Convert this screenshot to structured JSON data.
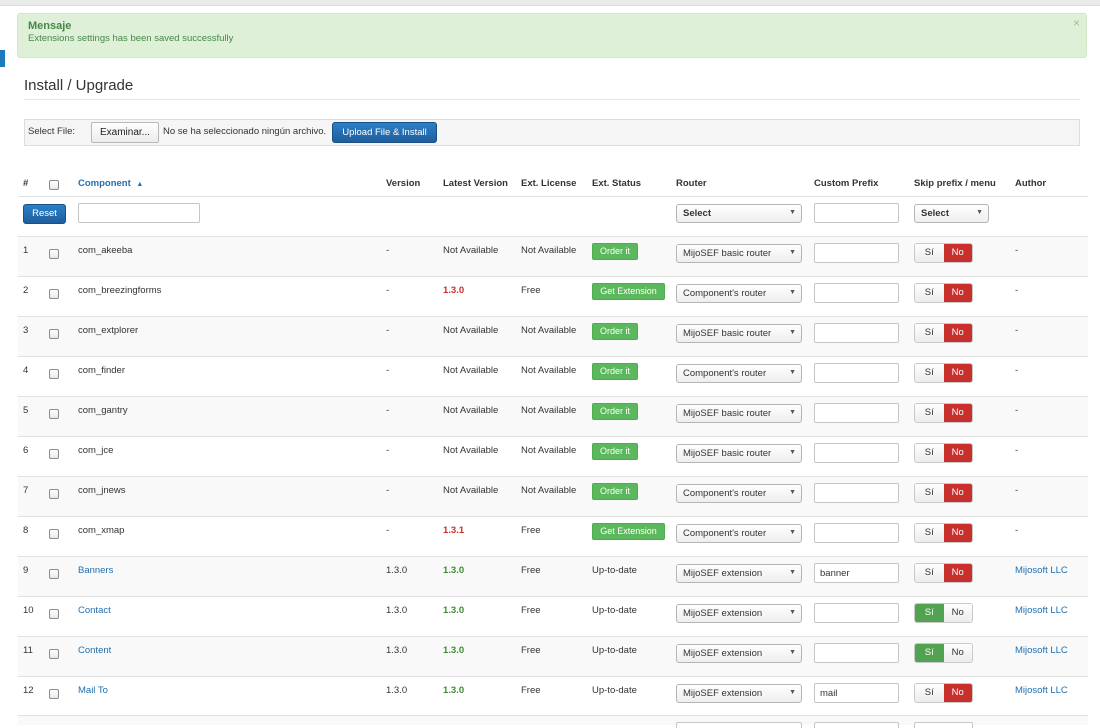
{
  "alert": {
    "heading": "Mensaje",
    "message": "Extensions settings has been saved successfully",
    "close": "×"
  },
  "page_title": "Install / Upgrade",
  "upload": {
    "label": "Select File:",
    "browse_label": "Examinar...",
    "no_file_text": "No se ha seleccionado ningún archivo.",
    "upload_button": "Upload File & Install"
  },
  "table": {
    "headers": {
      "num": "#",
      "component": "Component",
      "sort_indicator": "▲",
      "version": "Version",
      "latest_version": "Latest Version",
      "license": "Ext. License",
      "status": "Ext. Status",
      "router": "Router",
      "prefix": "Custom Prefix",
      "skip": "Skip prefix / menu",
      "author": "Author"
    },
    "filters": {
      "reset_label": "Reset",
      "router_select": "Select",
      "skip_select": "Select"
    },
    "toggle_labels": {
      "yes": "Sí",
      "no": "No"
    },
    "rows": [
      {
        "num": "1",
        "component": "com_akeeba",
        "version": "-",
        "latest": "Not Available",
        "license": "Not Available",
        "status": "Order it",
        "router": "MijoSEF basic router",
        "prefix": "",
        "skip": "No",
        "author": "-"
      },
      {
        "num": "2",
        "component": "com_breezingforms",
        "version": "-",
        "latest": "1.3.0",
        "license": "Free",
        "status": "Get Extension",
        "router": "Component's router",
        "prefix": "",
        "skip": "No",
        "author": "-"
      },
      {
        "num": "3",
        "component": "com_extplorer",
        "version": "-",
        "latest": "Not Available",
        "license": "Not Available",
        "status": "Order it",
        "router": "MijoSEF basic router",
        "prefix": "",
        "skip": "No",
        "author": "-"
      },
      {
        "num": "4",
        "component": "com_finder",
        "version": "-",
        "latest": "Not Available",
        "license": "Not Available",
        "status": "Order it",
        "router": "Component's router",
        "prefix": "",
        "skip": "No",
        "author": "-"
      },
      {
        "num": "5",
        "component": "com_gantry",
        "version": "-",
        "latest": "Not Available",
        "license": "Not Available",
        "status": "Order it",
        "router": "MijoSEF basic router",
        "prefix": "",
        "skip": "No",
        "author": "-"
      },
      {
        "num": "6",
        "component": "com_jce",
        "version": "-",
        "latest": "Not Available",
        "license": "Not Available",
        "status": "Order it",
        "router": "MijoSEF basic router",
        "prefix": "",
        "skip": "No",
        "author": "-"
      },
      {
        "num": "7",
        "component": "com_jnews",
        "version": "-",
        "latest": "Not Available",
        "license": "Not Available",
        "status": "Order it",
        "router": "Component's router",
        "prefix": "",
        "skip": "No",
        "author": "-"
      },
      {
        "num": "8",
        "component": "com_xmap",
        "version": "-",
        "latest": "1.3.1",
        "license": "Free",
        "status": "Get Extension",
        "router": "Component's router",
        "prefix": "",
        "skip": "No",
        "author": "-"
      },
      {
        "num": "9",
        "component": "Banners",
        "version": "1.3.0",
        "latest": "1.3.0",
        "license": "Free",
        "status": "Up-to-date",
        "router": "MijoSEF extension",
        "prefix": "banner",
        "skip": "No",
        "author": "Mijosoft LLC"
      },
      {
        "num": "10",
        "component": "Contact",
        "version": "1.3.0",
        "latest": "1.3.0",
        "license": "Free",
        "status": "Up-to-date",
        "router": "MijoSEF extension",
        "prefix": "",
        "skip": "Sí",
        "author": "Mijosoft LLC"
      },
      {
        "num": "11",
        "component": "Content",
        "version": "1.3.0",
        "latest": "1.3.0",
        "license": "Free",
        "status": "Up-to-date",
        "router": "MijoSEF extension",
        "prefix": "",
        "skip": "Sí",
        "author": "Mijosoft LLC"
      },
      {
        "num": "12",
        "component": "Mail To",
        "version": "1.3.0",
        "latest": "1.3.0",
        "license": "Free",
        "status": "Up-to-date",
        "router": "MijoSEF extension",
        "prefix": "mail",
        "skip": "No",
        "author": "Mijosoft LLC"
      }
    ]
  },
  "colors": {
    "success_bg": "#dff0d8",
    "primary": "#1f6fb2",
    "danger": "#c9302c",
    "success": "#51a351"
  },
  "icons": {
    "sort": "caret-up-icon",
    "select": "dropdown-caret-icon",
    "close": "close-icon"
  }
}
